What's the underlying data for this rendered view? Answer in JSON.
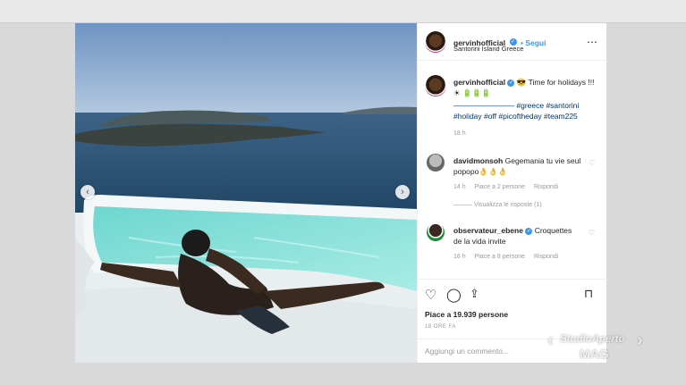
{
  "post": {
    "username": "gervinhofficial",
    "follow_label": "• Segui",
    "location": "Santorini Island Greece",
    "more_icon": "⋯",
    "caption_text": "😎 Time for holidays !!! ☀ 🔋🔋🔋",
    "caption_hashtags_1": "———————— #greece #santorini",
    "caption_hashtags_2": "#holiday #off #picoftheday #team225",
    "caption_time": "18 h"
  },
  "comments": [
    {
      "user": "davidmonsoh",
      "text": "Gegemania tu vie seul popopo👌👌👌",
      "time": "14 h",
      "likes": "Piace a 2 persone",
      "reply": "Rispondi",
      "view_replies": "——— Visualizza le risposte (1)"
    },
    {
      "user": "observateur_ebene",
      "text": "Croquettes de la vida invite",
      "time": "16 h",
      "likes": "Piace a 8 persone",
      "reply": "Rispondi"
    }
  ],
  "actions": {
    "likes": "Piace a 19.939 persone",
    "time": "18 ORE FA",
    "add_comment_placeholder": "Aggiungi un commento..."
  },
  "watermark": {
    "line1": "StudioAperto",
    "line2": "MAG"
  },
  "colors": {
    "accent": "#3897f0",
    "story_ring": "#d12a6b"
  },
  "icons": [
    "chevron-left-icon",
    "chevron-right-icon",
    "heart-icon",
    "comment-icon",
    "share-icon",
    "bookmark-icon",
    "verified-icon",
    "more-icon"
  ]
}
